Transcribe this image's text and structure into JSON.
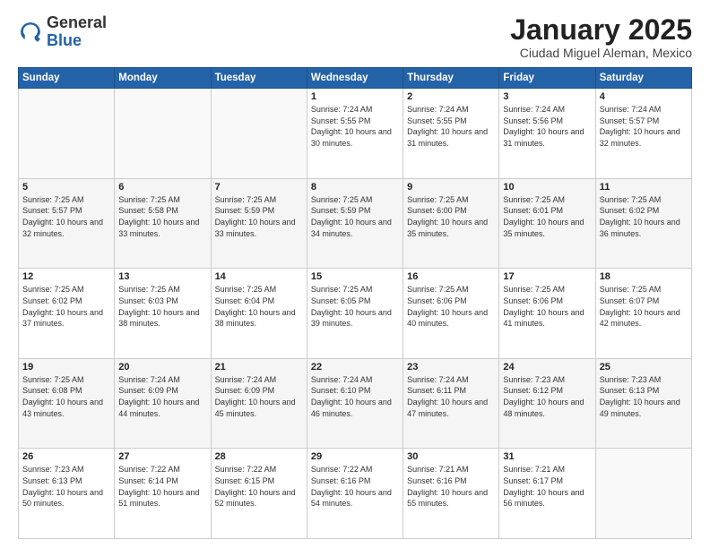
{
  "logo": {
    "general": "General",
    "blue": "Blue"
  },
  "header": {
    "month_title": "January 2025",
    "location": "Ciudad Miguel Aleman, Mexico"
  },
  "weekdays": [
    "Sunday",
    "Monday",
    "Tuesday",
    "Wednesday",
    "Thursday",
    "Friday",
    "Saturday"
  ],
  "weeks": [
    [
      {
        "day": "",
        "info": ""
      },
      {
        "day": "",
        "info": ""
      },
      {
        "day": "",
        "info": ""
      },
      {
        "day": "1",
        "info": "Sunrise: 7:24 AM\nSunset: 5:55 PM\nDaylight: 10 hours\nand 30 minutes."
      },
      {
        "day": "2",
        "info": "Sunrise: 7:24 AM\nSunset: 5:55 PM\nDaylight: 10 hours\nand 31 minutes."
      },
      {
        "day": "3",
        "info": "Sunrise: 7:24 AM\nSunset: 5:56 PM\nDaylight: 10 hours\nand 31 minutes."
      },
      {
        "day": "4",
        "info": "Sunrise: 7:24 AM\nSunset: 5:57 PM\nDaylight: 10 hours\nand 32 minutes."
      }
    ],
    [
      {
        "day": "5",
        "info": "Sunrise: 7:25 AM\nSunset: 5:57 PM\nDaylight: 10 hours\nand 32 minutes."
      },
      {
        "day": "6",
        "info": "Sunrise: 7:25 AM\nSunset: 5:58 PM\nDaylight: 10 hours\nand 33 minutes."
      },
      {
        "day": "7",
        "info": "Sunrise: 7:25 AM\nSunset: 5:59 PM\nDaylight: 10 hours\nand 33 minutes."
      },
      {
        "day": "8",
        "info": "Sunrise: 7:25 AM\nSunset: 5:59 PM\nDaylight: 10 hours\nand 34 minutes."
      },
      {
        "day": "9",
        "info": "Sunrise: 7:25 AM\nSunset: 6:00 PM\nDaylight: 10 hours\nand 35 minutes."
      },
      {
        "day": "10",
        "info": "Sunrise: 7:25 AM\nSunset: 6:01 PM\nDaylight: 10 hours\nand 35 minutes."
      },
      {
        "day": "11",
        "info": "Sunrise: 7:25 AM\nSunset: 6:02 PM\nDaylight: 10 hours\nand 36 minutes."
      }
    ],
    [
      {
        "day": "12",
        "info": "Sunrise: 7:25 AM\nSunset: 6:02 PM\nDaylight: 10 hours\nand 37 minutes."
      },
      {
        "day": "13",
        "info": "Sunrise: 7:25 AM\nSunset: 6:03 PM\nDaylight: 10 hours\nand 38 minutes."
      },
      {
        "day": "14",
        "info": "Sunrise: 7:25 AM\nSunset: 6:04 PM\nDaylight: 10 hours\nand 38 minutes."
      },
      {
        "day": "15",
        "info": "Sunrise: 7:25 AM\nSunset: 6:05 PM\nDaylight: 10 hours\nand 39 minutes."
      },
      {
        "day": "16",
        "info": "Sunrise: 7:25 AM\nSunset: 6:06 PM\nDaylight: 10 hours\nand 40 minutes."
      },
      {
        "day": "17",
        "info": "Sunrise: 7:25 AM\nSunset: 6:06 PM\nDaylight: 10 hours\nand 41 minutes."
      },
      {
        "day": "18",
        "info": "Sunrise: 7:25 AM\nSunset: 6:07 PM\nDaylight: 10 hours\nand 42 minutes."
      }
    ],
    [
      {
        "day": "19",
        "info": "Sunrise: 7:25 AM\nSunset: 6:08 PM\nDaylight: 10 hours\nand 43 minutes."
      },
      {
        "day": "20",
        "info": "Sunrise: 7:24 AM\nSunset: 6:09 PM\nDaylight: 10 hours\nand 44 minutes."
      },
      {
        "day": "21",
        "info": "Sunrise: 7:24 AM\nSunset: 6:09 PM\nDaylight: 10 hours\nand 45 minutes."
      },
      {
        "day": "22",
        "info": "Sunrise: 7:24 AM\nSunset: 6:10 PM\nDaylight: 10 hours\nand 46 minutes."
      },
      {
        "day": "23",
        "info": "Sunrise: 7:24 AM\nSunset: 6:11 PM\nDaylight: 10 hours\nand 47 minutes."
      },
      {
        "day": "24",
        "info": "Sunrise: 7:23 AM\nSunset: 6:12 PM\nDaylight: 10 hours\nand 48 minutes."
      },
      {
        "day": "25",
        "info": "Sunrise: 7:23 AM\nSunset: 6:13 PM\nDaylight: 10 hours\nand 49 minutes."
      }
    ],
    [
      {
        "day": "26",
        "info": "Sunrise: 7:23 AM\nSunset: 6:13 PM\nDaylight: 10 hours\nand 50 minutes."
      },
      {
        "day": "27",
        "info": "Sunrise: 7:22 AM\nSunset: 6:14 PM\nDaylight: 10 hours\nand 51 minutes."
      },
      {
        "day": "28",
        "info": "Sunrise: 7:22 AM\nSunset: 6:15 PM\nDaylight: 10 hours\nand 52 minutes."
      },
      {
        "day": "29",
        "info": "Sunrise: 7:22 AM\nSunset: 6:16 PM\nDaylight: 10 hours\nand 54 minutes."
      },
      {
        "day": "30",
        "info": "Sunrise: 7:21 AM\nSunset: 6:16 PM\nDaylight: 10 hours\nand 55 minutes."
      },
      {
        "day": "31",
        "info": "Sunrise: 7:21 AM\nSunset: 6:17 PM\nDaylight: 10 hours\nand 56 minutes."
      },
      {
        "day": "",
        "info": ""
      }
    ]
  ]
}
